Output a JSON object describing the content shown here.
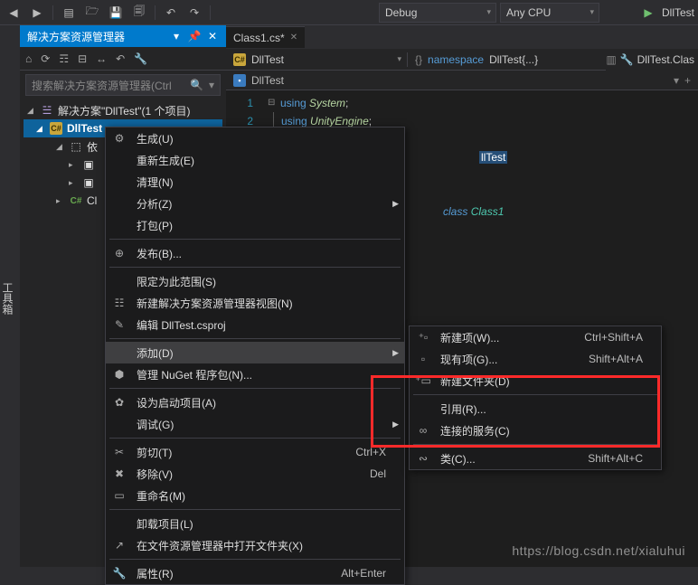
{
  "toolbar": {
    "config": "Debug",
    "platform": "Any CPU",
    "run": "DllTest"
  },
  "panel": {
    "title": "解决方案资源管理器",
    "search_placeholder": "搜索解决方案资源管理器(Ctrl"
  },
  "tree": {
    "solution": "解决方案\"DllTest\"(1 个项目)",
    "project": "DllTest",
    "deps": "依",
    "class": "Cl"
  },
  "editor": {
    "tab": "Class1.cs*",
    "nav1_box": "DllTest",
    "nav2_ns": "namespace",
    "nav2_name": "DllTest{...}",
    "breadcrumb": "DllTest",
    "navright": "DllTest.Clas",
    "code": {
      "l1_using": "using",
      "l1_ns": "System",
      "l2_using": "using",
      "l2_ns": "UnityEngine",
      "sel_ns": "llTest",
      "class_kw": "class",
      "class_name": "Class1"
    }
  },
  "menu1": [
    {
      "icon": "⚙",
      "label": "生成(U)"
    },
    {
      "icon": "",
      "label": "重新生成(E)"
    },
    {
      "icon": "",
      "label": "清理(N)"
    },
    {
      "icon": "",
      "label": "分析(Z)",
      "arrow": true
    },
    {
      "icon": "",
      "label": "打包(P)"
    },
    {
      "sep": true
    },
    {
      "icon": "⊕",
      "label": "发布(B)..."
    },
    {
      "sep": true
    },
    {
      "icon": "",
      "label": "限定为此范围(S)"
    },
    {
      "icon": "☷",
      "label": "新建解决方案资源管理器视图(N)"
    },
    {
      "icon": "✎",
      "label": "编辑 DllTest.csproj"
    },
    {
      "sep": true
    },
    {
      "icon": "",
      "label": "添加(D)",
      "arrow": true,
      "hi": true
    },
    {
      "icon": "⬢",
      "label": "管理 NuGet 程序包(N)..."
    },
    {
      "sep": true
    },
    {
      "icon": "✿",
      "label": "设为启动项目(A)"
    },
    {
      "icon": "",
      "label": "调试(G)",
      "arrow": true
    },
    {
      "sep": true
    },
    {
      "icon": "✂",
      "label": "剪切(T)",
      "short": "Ctrl+X"
    },
    {
      "icon": "✖",
      "label": "移除(V)",
      "short": "Del"
    },
    {
      "icon": "▭",
      "label": "重命名(M)"
    },
    {
      "sep": true
    },
    {
      "icon": "",
      "label": "卸载项目(L)"
    },
    {
      "icon": "↗",
      "label": "在文件资源管理器中打开文件夹(X)"
    },
    {
      "sep": true
    },
    {
      "icon": "🔧",
      "label": "属性(R)",
      "short": "Alt+Enter"
    }
  ],
  "menu2": [
    {
      "icon": "⁺▫",
      "label": "新建项(W)...",
      "short": "Ctrl+Shift+A"
    },
    {
      "icon": "▫",
      "label": "现有项(G)...",
      "short": "Shift+Alt+A"
    },
    {
      "icon": "⁺▭",
      "label": "新建文件夹(D)"
    },
    {
      "sep": true
    },
    {
      "icon": "",
      "label": "引用(R)..."
    },
    {
      "icon": "∞",
      "label": "连接的服务(C)"
    },
    {
      "sep": true
    },
    {
      "icon": "∾",
      "label": "类(C)...",
      "short": "Shift+Alt+C"
    }
  ],
  "watermark": "https://blog.csdn.net/xialuhui"
}
